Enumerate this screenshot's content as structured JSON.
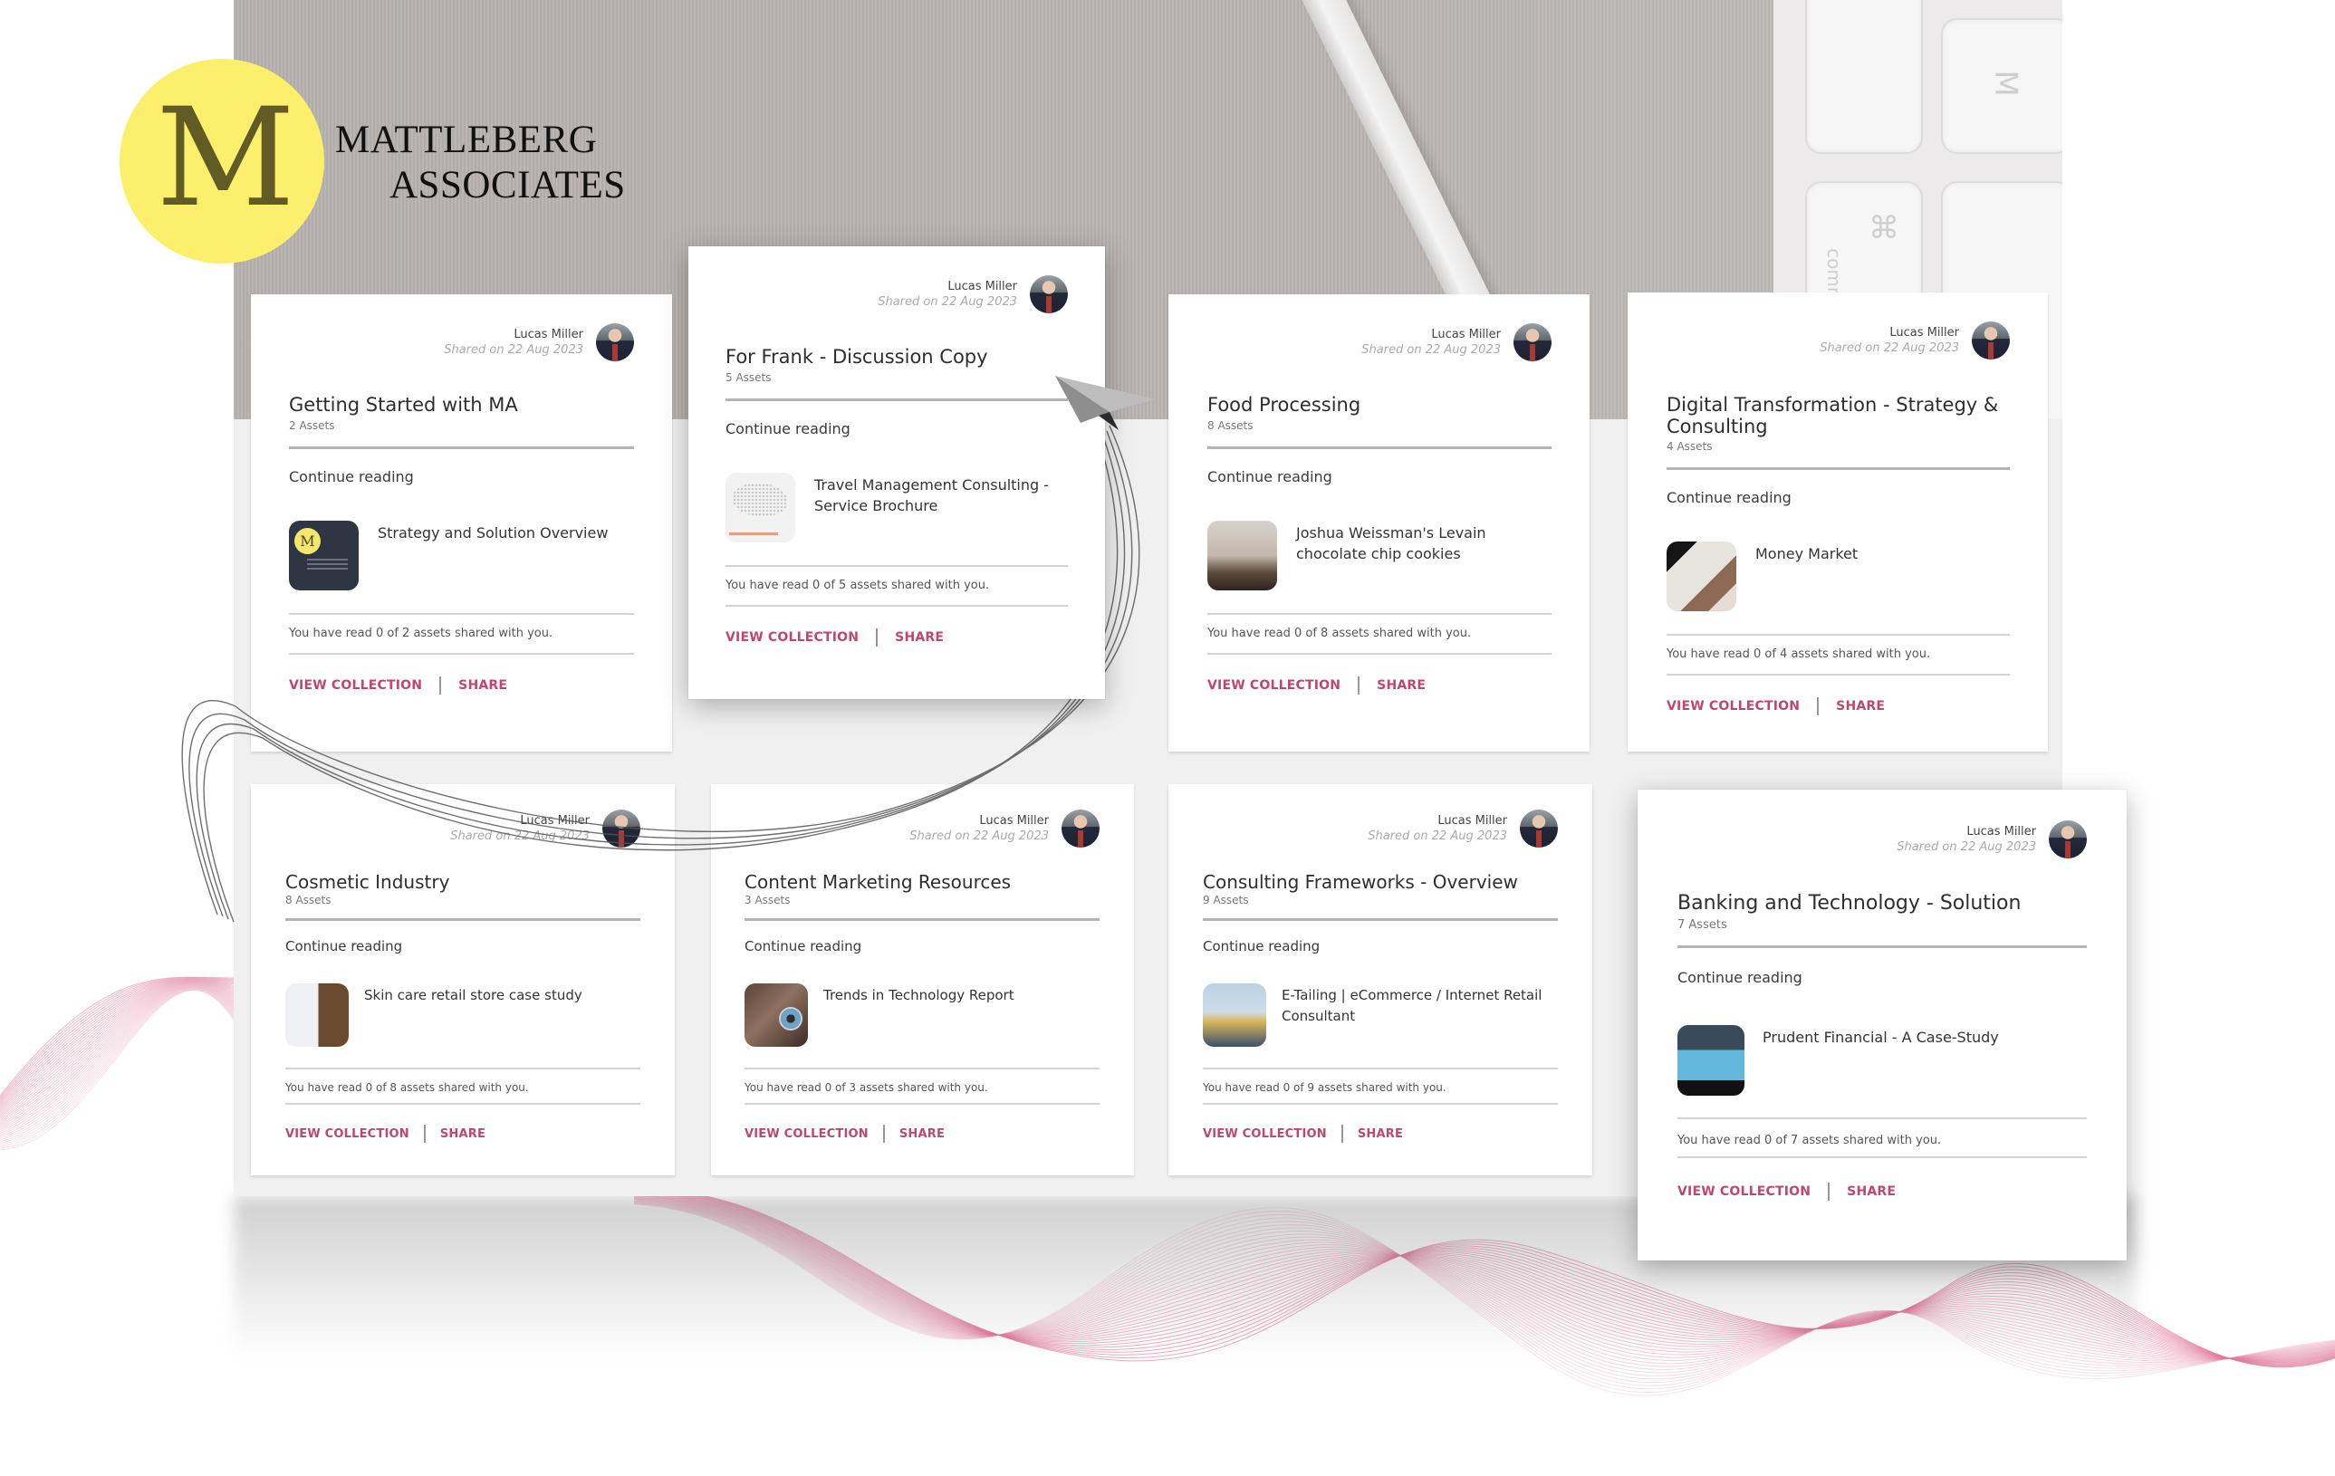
{
  "brand": {
    "monogram": "M",
    "name_line1": "MATTLEBERG",
    "name_line2": "ASSOCIATES",
    "logo_color": "#fbef6b"
  },
  "theme": {
    "accent": "#c0466e",
    "panel_bg": "#f0f0f0"
  },
  "common": {
    "sharer_name": "Lucas Miller",
    "shared_date": "Shared on 22 Aug 2023",
    "continue_label": "Continue reading",
    "view_collection_label": "VIEW COLLECTION",
    "share_label": "SHARE"
  },
  "collections": [
    {
      "title": "Getting Started with MA",
      "asset_count": "2 Assets",
      "sharer_name": "Lucas Miller",
      "shared_date": "Shared on 22 Aug 2023",
      "continue_label": "Continue reading",
      "asset_title": "Strategy and Solution Overview",
      "progress": "You have read 0 of 2 assets shared with you.",
      "read": 0,
      "total": 2,
      "view_collection_label": "VIEW COLLECTION",
      "share_label": "SHARE"
    },
    {
      "title": "For Frank - Discussion Copy",
      "asset_count": "5 Assets",
      "sharer_name": "Lucas Miller",
      "shared_date": "Shared on 22 Aug 2023",
      "continue_label": "Continue reading",
      "asset_title": "Travel Management Consulting - Service Brochure",
      "progress": "You have read 0 of 5 assets shared with you.",
      "read": 0,
      "total": 5,
      "view_collection_label": "VIEW COLLECTION",
      "share_label": "SHARE"
    },
    {
      "title": "Food Processing",
      "asset_count": "8 Assets",
      "sharer_name": "Lucas Miller",
      "shared_date": "Shared on 22 Aug 2023",
      "continue_label": "Continue reading",
      "asset_title": "Joshua Weissman's Levain chocolate chip cookies",
      "progress": "You have read 0 of 8 assets shared with you.",
      "read": 0,
      "total": 8,
      "view_collection_label": "VIEW COLLECTION",
      "share_label": "SHARE"
    },
    {
      "title": "Digital Transformation - Strategy & Consulting",
      "asset_count": "4 Assets",
      "sharer_name": "Lucas Miller",
      "shared_date": "Shared on 22 Aug 2023",
      "continue_label": "Continue reading",
      "asset_title": "Money Market",
      "progress": "You have read 0 of 4 assets shared with you.",
      "read": 0,
      "total": 4,
      "view_collection_label": "VIEW COLLECTION",
      "share_label": "SHARE"
    },
    {
      "title": "Cosmetic Industry",
      "asset_count": "8 Assets",
      "sharer_name": "Lucas Miller",
      "shared_date": "Shared on 22 Aug 2023",
      "continue_label": "Continue reading",
      "asset_title": "Skin care retail store case study",
      "progress": "You have read 0 of 8 assets shared with you.",
      "read": 0,
      "total": 8,
      "view_collection_label": "VIEW COLLECTION",
      "share_label": "SHARE"
    },
    {
      "title": "Content Marketing Resources",
      "asset_count": "3 Assets",
      "sharer_name": "Lucas Miller",
      "shared_date": "Shared on 22 Aug 2023",
      "continue_label": "Continue reading",
      "asset_title": "Trends in Technology Report",
      "progress": "You have read 0 of 3 assets shared with you.",
      "read": 0,
      "total": 3,
      "view_collection_label": "VIEW COLLECTION",
      "share_label": "SHARE"
    },
    {
      "title": "Consulting Frameworks - Overview",
      "asset_count": "9 Assets",
      "sharer_name": "Lucas Miller",
      "shared_date": "Shared on 22 Aug 2023",
      "continue_label": "Continue reading",
      "asset_title": "E-Tailing | eCommerce / Internet Retail Consultant",
      "progress": "You have read 0 of 9 assets shared with you.",
      "read": 0,
      "total": 9,
      "view_collection_label": "VIEW COLLECTION",
      "share_label": "SHARE"
    },
    {
      "title": "Banking and Technology - Solution",
      "asset_count": "7 Assets",
      "sharer_name": "Lucas Miller",
      "shared_date": "Shared on 22 Aug 2023",
      "continue_label": "Continue reading",
      "asset_title": "Prudent Financial - A Case-Study",
      "progress": "You have read 0 of 7 assets shared with you.",
      "read": 0,
      "total": 7,
      "view_collection_label": "VIEW COLLECTION",
      "share_label": "SHARE"
    }
  ],
  "decor": {
    "keyboard_keys": [
      "M",
      "⌘",
      "command"
    ]
  }
}
